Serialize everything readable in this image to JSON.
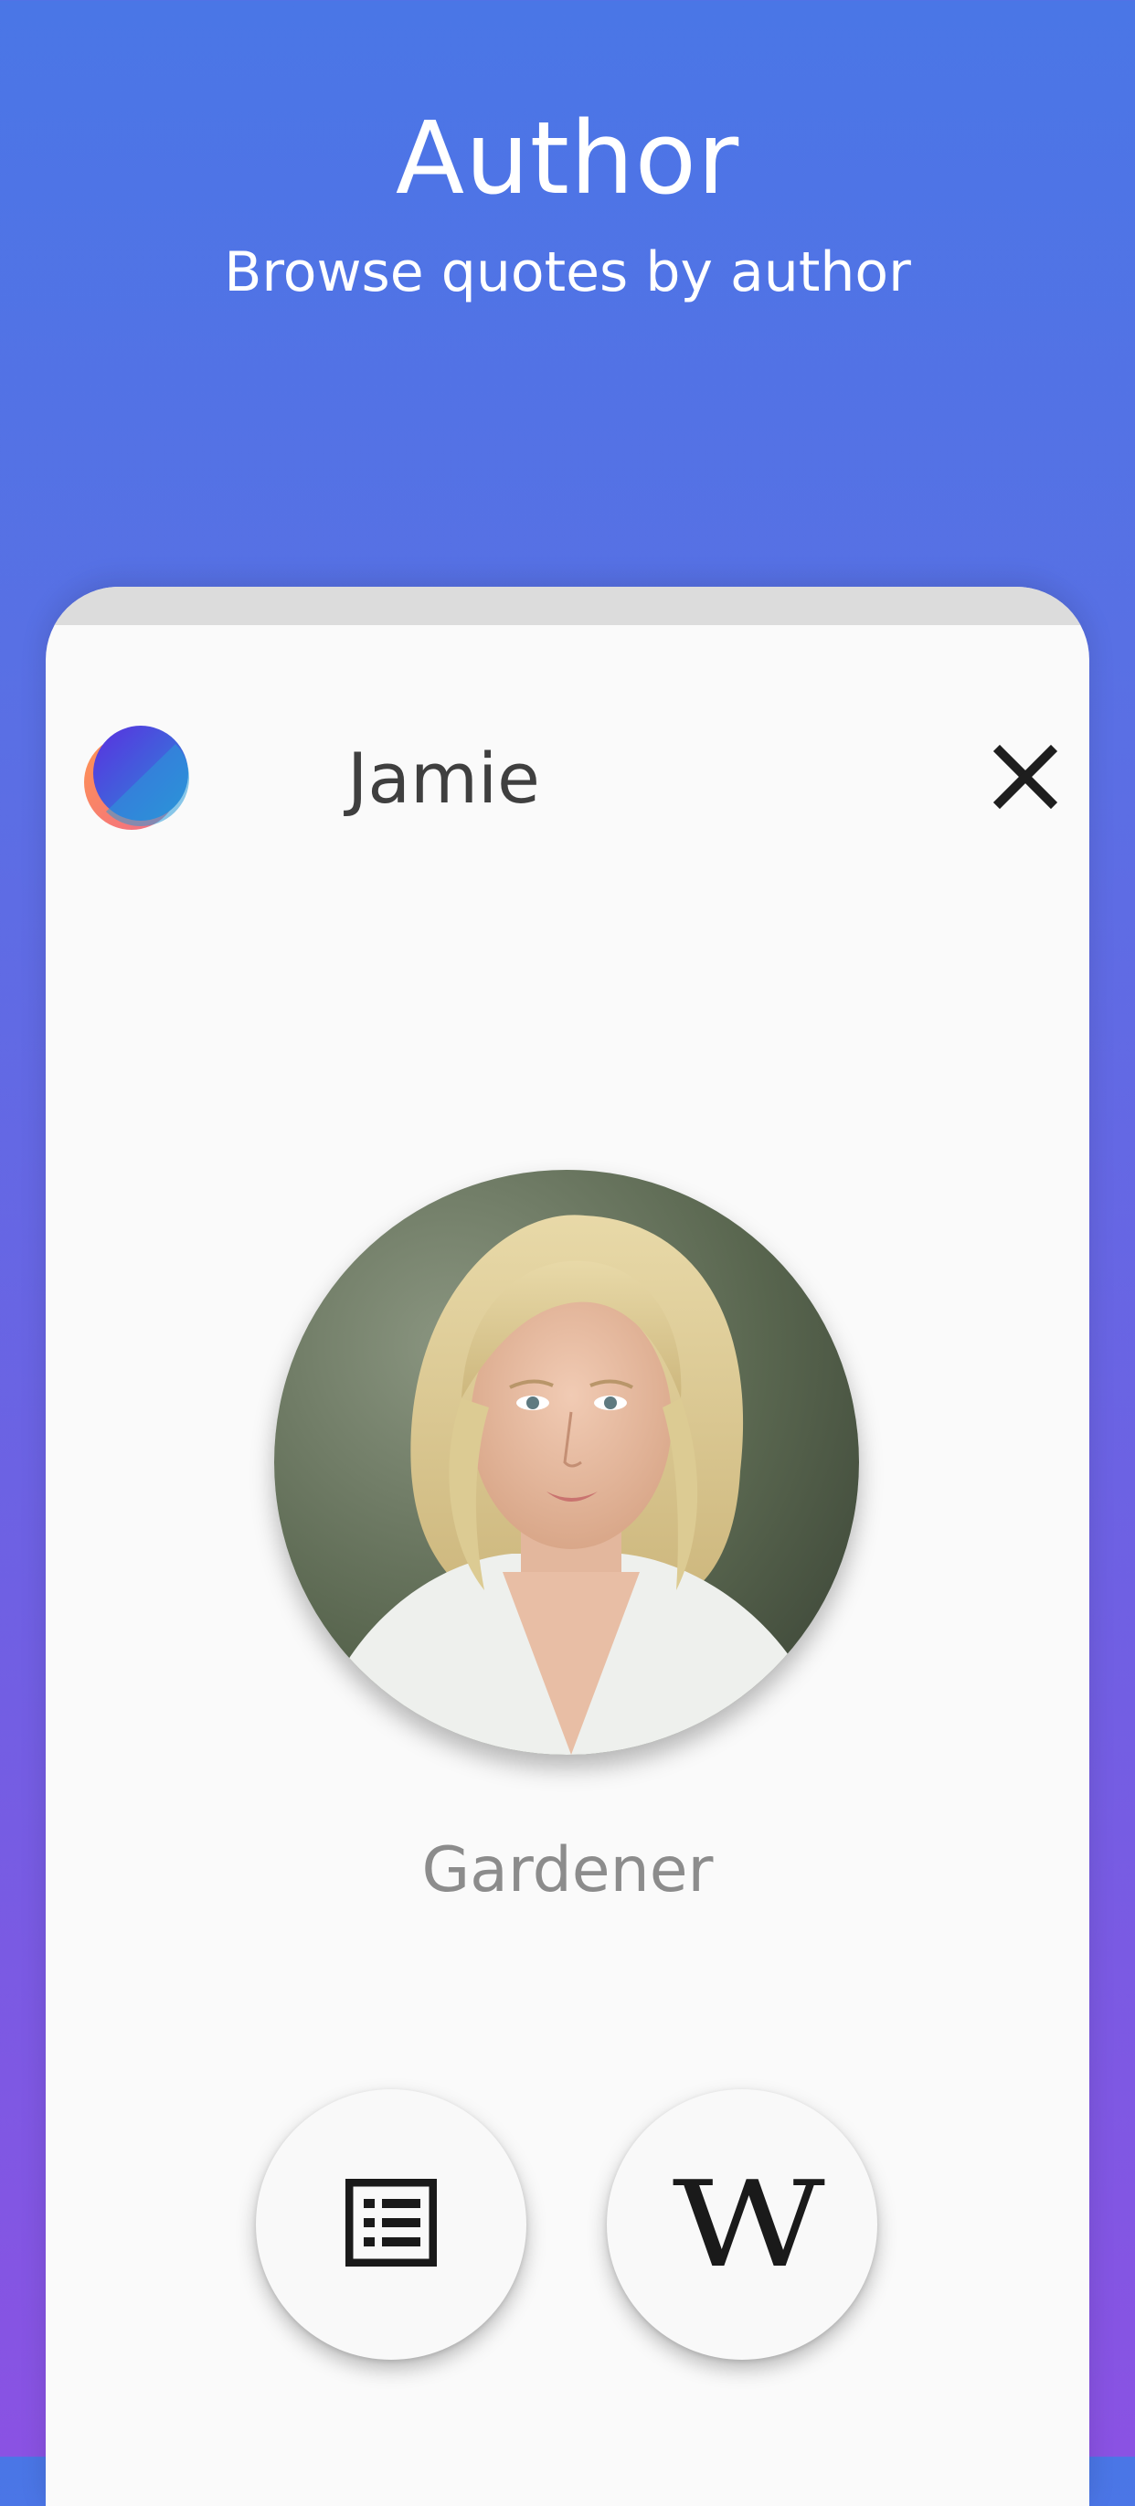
{
  "hero": {
    "title": "Author",
    "subtitle": "Browse quotes by author"
  },
  "header": {
    "author_name": "Jamie",
    "close_icon": "close-icon",
    "logo_icon": "app-logo"
  },
  "profile": {
    "occupation": "Gardener"
  },
  "actions": {
    "quotes_icon": "list-icon",
    "wiki_label": "W"
  },
  "colors": {
    "gradient_top": "#4a76e6",
    "gradient_bottom": "#8a52e3",
    "card": "#fafafa",
    "status_strip": "#dcdcdc"
  }
}
